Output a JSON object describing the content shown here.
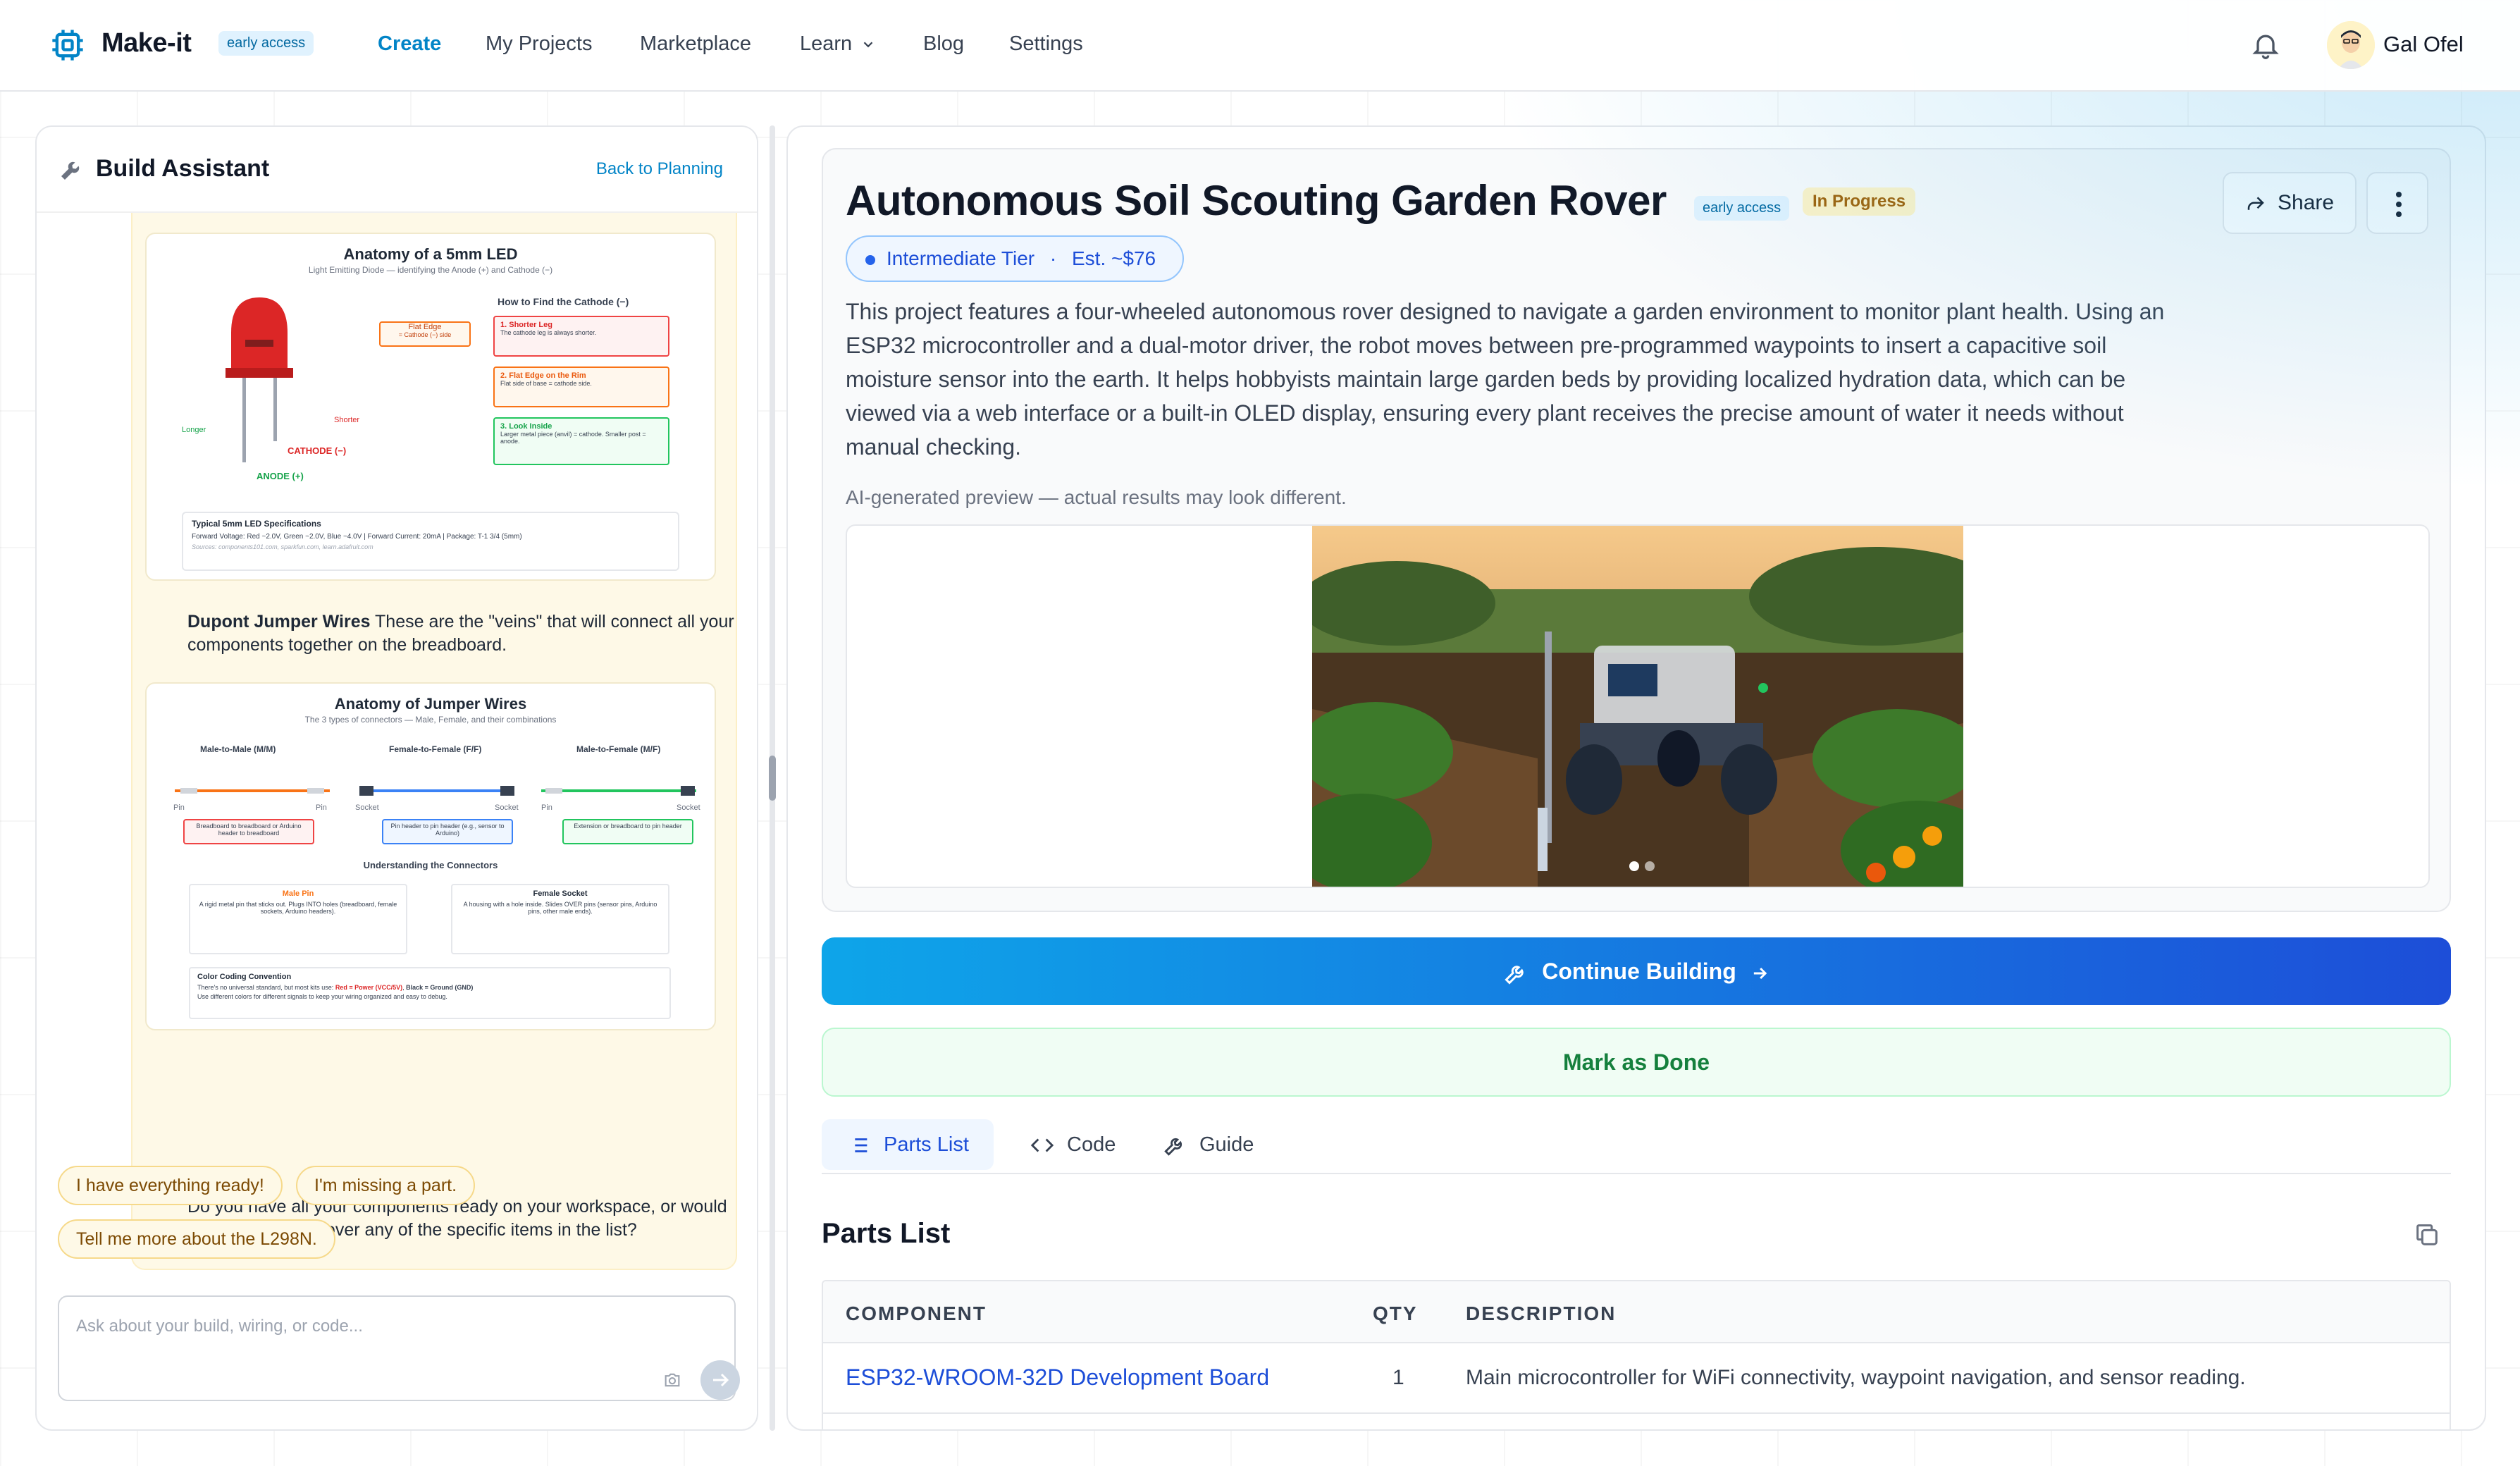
{
  "nav": {
    "app_name": "Make-it",
    "early_access": "early access",
    "links": [
      "Create",
      "My Projects",
      "Marketplace",
      "Learn",
      "Blog",
      "Settings"
    ],
    "user_name": "Gal Ofel"
  },
  "assistant": {
    "title": "Build Assistant",
    "back_link": "Back to Planning",
    "led_diagram": {
      "title": "Anatomy of a 5mm LED",
      "subtitle": "Light Emitting Diode — identifying the Anode (+) and Cathode (−)",
      "how_to": "How to Find the Cathode (−)",
      "tip1_title": "1. Shorter Leg",
      "tip1_text": "The cathode leg is always shorter.",
      "tip2_title": "2. Flat Edge on the Rim",
      "tip2_text": "Flat side of base = cathode side.",
      "tip3_title": "3. Look Inside",
      "tip3_text": "Larger metal piece (anvil) = cathode. Smaller post = anode.",
      "flat_edge": "Flat Edge",
      "flat_edge_sub": "= Cathode (−) side",
      "longer": "Longer",
      "shorter": "Shorter",
      "cathode": "CATHODE (−)",
      "anode": "ANODE (+)",
      "spec_title": "Typical 5mm LED Specifications",
      "spec_text": "Forward Voltage: Red ~2.0V, Green ~2.0V, Blue ~4.0V | Forward Current: 20mA | Package: T-1 3/4 (5mm)",
      "sources": "Sources: components101.com, sparkfun.com, learn.adafruit.com"
    },
    "jumper_heading": "Dupont Jumper Wires",
    "jumper_text": " These are the \"veins\" that will connect all your components together on the breadboard.",
    "jumper_diagram": {
      "title": "Anatomy of Jumper Wires",
      "subtitle": "The 3 types of connectors — Male, Female, and their combinations",
      "mm": "Male-to-Male (M/M)",
      "ff": "Female-to-Female (F/F)",
      "mf": "Male-to-Female (M/F)",
      "pin": "Pin",
      "socket": "Socket",
      "mm_use": "Breadboard to breadboard or Arduino header to breadboard",
      "ff_use": "Pin header to pin header (e.g., sensor to Arduino)",
      "mf_use": "Extension or breadboard to pin header",
      "understanding": "Understanding the Connectors",
      "male_pin": "Male Pin",
      "male_pin_text": "A rigid metal pin that sticks out. Plugs INTO holes (breadboard, female sockets, Arduino headers).",
      "female_socket": "Female Socket",
      "female_socket_text": "A housing with a hole inside. Slides OVER pins (sensor pins, Arduino pins, other male ends).",
      "color_title": "Color Coding Convention",
      "color_text_1": "There's no universal standard, but most kits use: ",
      "color_red": "Red = Power (VCC/5V)",
      "color_sep": ", ",
      "color_black": "Black = Ground (GND)",
      "color_text_2": "Use different colors for different signals to keep your wiring organized and easy to debug."
    },
    "question": "Do you have all your components ready on your workspace, or would you like me to go over any of the specific items in the list?",
    "chips": [
      "I have everything ready!",
      "I'm missing a part.",
      "Tell me more about the L298N."
    ],
    "input_placeholder": "Ask about your build, wiring, or code..."
  },
  "project": {
    "title": "Autonomous Soil Scouting Garden Rover",
    "early_access": "early access",
    "status": "In Progress",
    "tier": "Intermediate Tier",
    "cost": "Est. ~$76",
    "share": "Share",
    "description": "This project features a four-wheeled autonomous rover designed to navigate a garden environment to monitor plant health. Using an ESP32 microcontroller and a dual-motor driver, the robot moves between pre-programmed waypoints to insert a capacitive soil moisture sensor into the earth. It helps hobbyists maintain large garden beds by providing localized hydration data, which can be viewed via a web interface or a built-in OLED display, ensuring every plant receives the precise amount of water it needs without manual checking.",
    "ai_note": "AI-generated preview — actual results may look different.",
    "continue": "Continue Building",
    "mark_done": "Mark as Done",
    "tabs": [
      "Parts List",
      "Code",
      "Guide"
    ],
    "section_title": "Parts List",
    "table": {
      "headers": [
        "COMPONENT",
        "QTY",
        "DESCRIPTION"
      ],
      "rows": [
        {
          "component": "ESP32-WROOM-32D Development Board",
          "qty": "1",
          "description": "Main microcontroller for WiFi connectivity, waypoint navigation, and sensor reading."
        }
      ]
    }
  }
}
